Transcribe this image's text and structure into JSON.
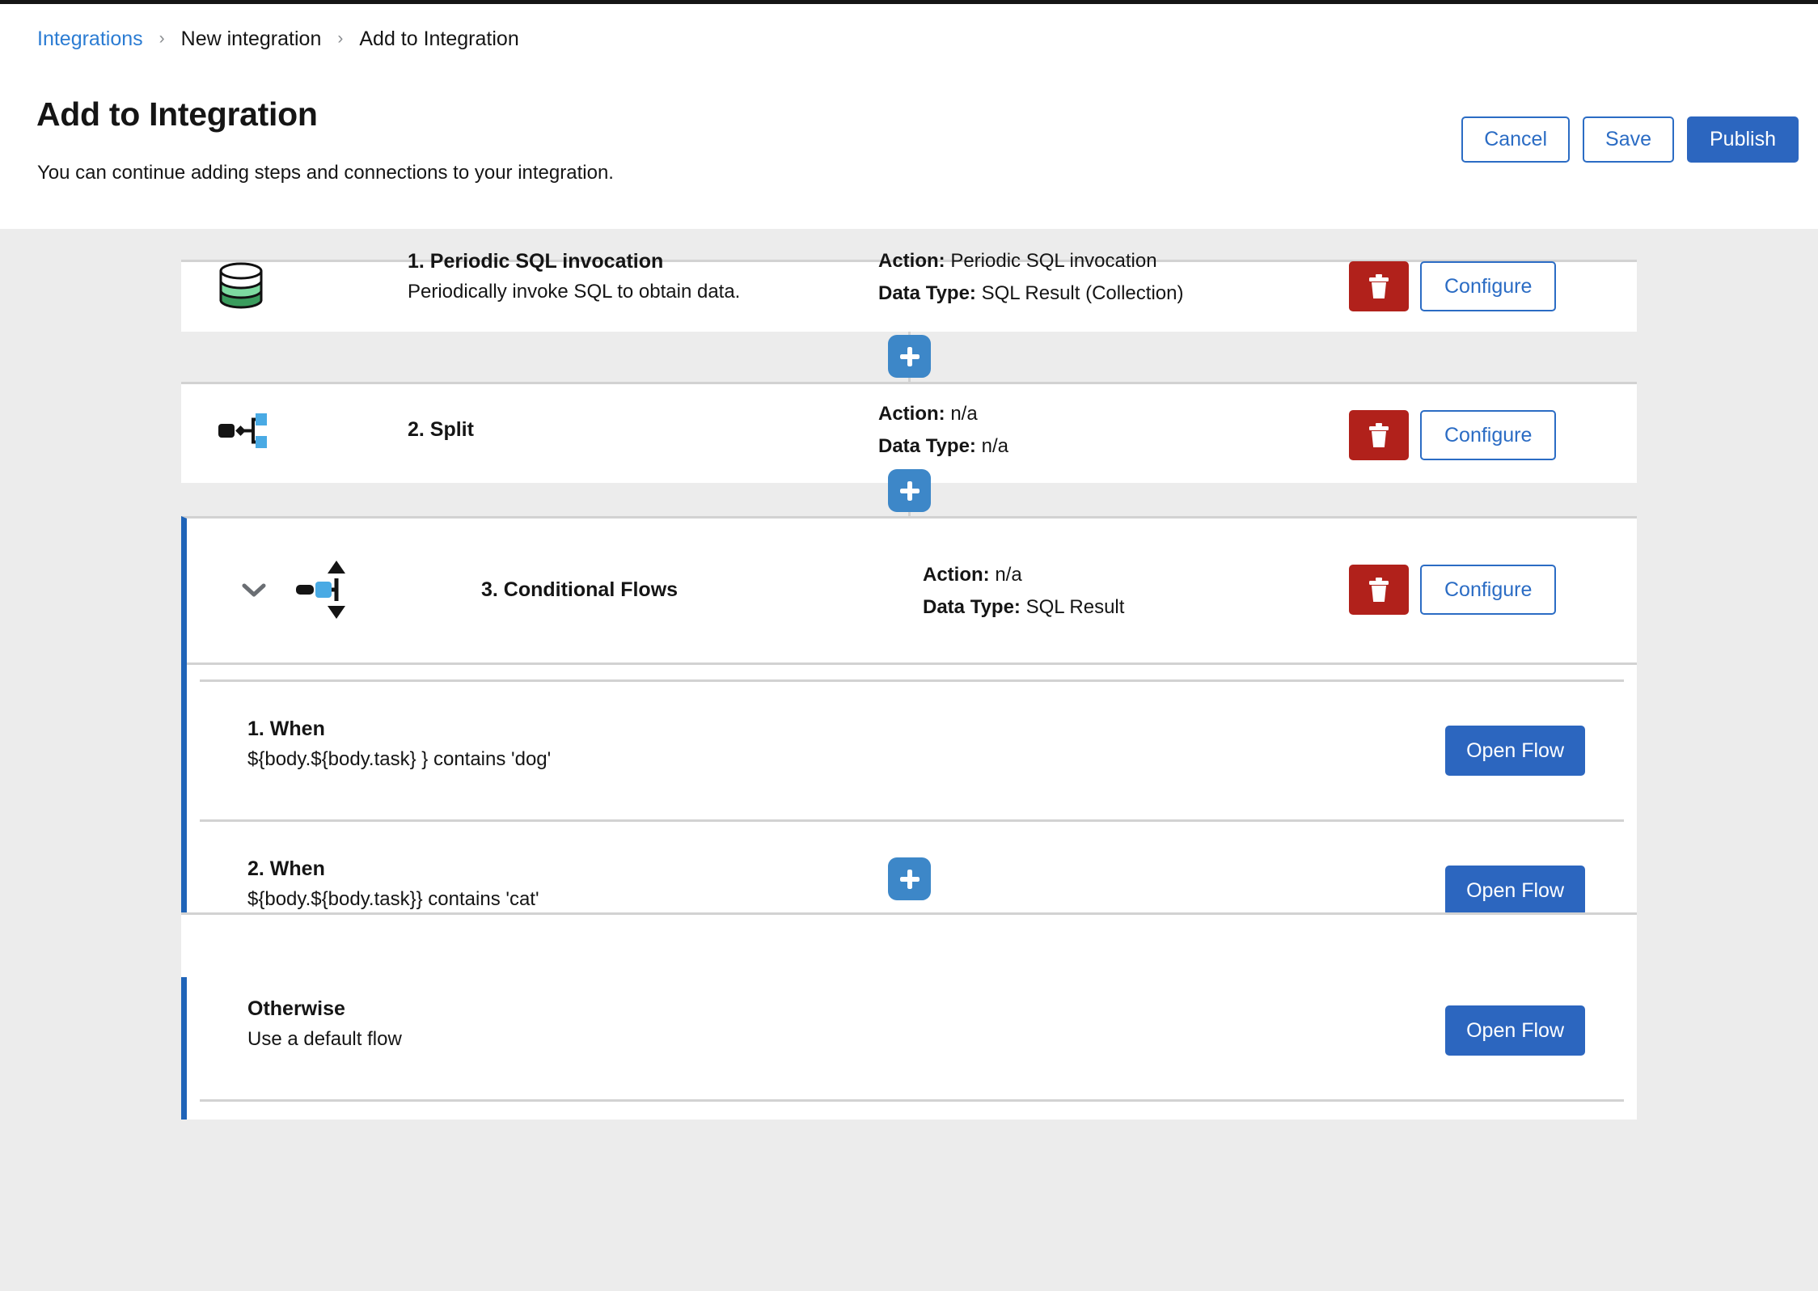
{
  "breadcrumb": {
    "items": [
      {
        "label": "Integrations",
        "link": true
      },
      {
        "label": "New integration",
        "link": false
      },
      {
        "label": "Add to Integration",
        "link": false
      }
    ],
    "separator": "›"
  },
  "header": {
    "title": "Add to Integration",
    "subtitle": "You can continue adding steps and connections to your integration.",
    "cancel_label": "Cancel",
    "save_label": "Save",
    "publish_label": "Publish"
  },
  "labels": {
    "action_label": "Action:",
    "data_type_label": "Data Type:",
    "configure_label": "Configure",
    "open_flow_label": "Open Flow",
    "delete_icon": "trash-icon",
    "add_icon": "plus-icon",
    "collapse_icon": "chevron-down-icon"
  },
  "steps": [
    {
      "icon": "database-icon",
      "title": "1. Periodic SQL invocation",
      "description": "Periodically invoke SQL to obtain data.",
      "action_value": "Periodic SQL invocation",
      "data_type_value": "SQL Result (Collection)"
    },
    {
      "icon": "split-icon",
      "title": "2. Split",
      "description": "",
      "action_value": "n/a",
      "data_type_value": "n/a"
    }
  ],
  "conditional": {
    "icon": "conditional-flow-icon",
    "title": "3. Conditional Flows",
    "action_value": "n/a",
    "data_type_value": "SQL Result",
    "flows": [
      {
        "title": "1. When",
        "condition": "${body.${body.task} } contains 'dog'",
        "button_label": "Open Flow"
      },
      {
        "title": "2. When",
        "condition": "${body.${body.task}} contains 'cat'",
        "button_label": "Open Flow"
      },
      {
        "title": "Otherwise",
        "condition": "Use a default flow",
        "button_label": "Open Flow"
      }
    ]
  },
  "colors": {
    "accent_blue": "#2c66bf",
    "link_blue": "#2b7cd3",
    "danger_red": "#b1211b",
    "add_blue": "#3d87c8",
    "page_bg": "#ececec",
    "border_gray": "#d2d2d2",
    "cond_border": "#1f64b8"
  }
}
